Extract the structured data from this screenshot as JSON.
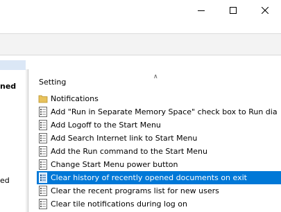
{
  "window": {
    "controls": [
      "minimize",
      "maximize",
      "close"
    ]
  },
  "left_pane": {
    "items": [
      "ned",
      "ed"
    ]
  },
  "list": {
    "column_header": "Setting",
    "rows": [
      {
        "label": "Notifications",
        "icon": "folder-icon"
      },
      {
        "label": "Add \"Run in Separate Memory Space\" check box to Run dia",
        "icon": "policy-setting-icon"
      },
      {
        "label": "Add Logoff to the Start Menu",
        "icon": "policy-setting-icon"
      },
      {
        "label": "Add Search Internet link to Start Menu",
        "icon": "policy-setting-icon"
      },
      {
        "label": "Add the Run command to the Start Menu",
        "icon": "policy-setting-icon"
      },
      {
        "label": "Change Start Menu power button",
        "icon": "policy-setting-icon"
      },
      {
        "label": "Clear history of recently opened documents on exit",
        "icon": "policy-setting-icon",
        "selected": true
      },
      {
        "label": "Clear the recent programs list for new users",
        "icon": "policy-setting-icon"
      },
      {
        "label": "Clear tile notifications during log on",
        "icon": "policy-setting-icon"
      }
    ]
  },
  "colors": {
    "selection": "#0078d7",
    "folder": "#e8c25c"
  }
}
